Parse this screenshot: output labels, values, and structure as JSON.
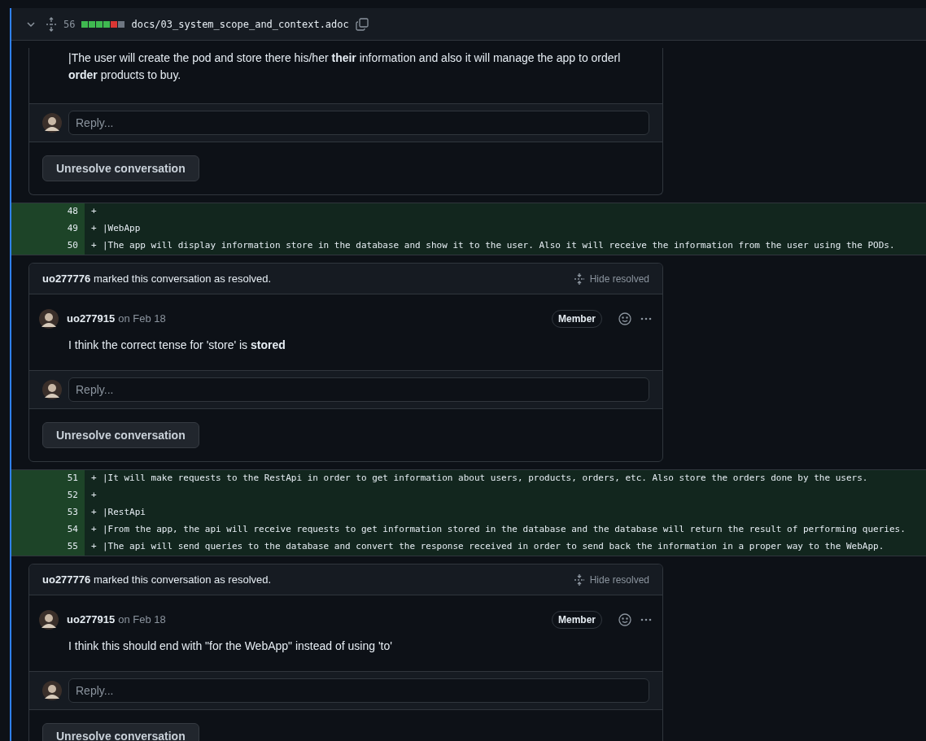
{
  "file_header": {
    "expanded": true,
    "changes": "56",
    "diffstat": [
      {
        "color": "#3fb950"
      },
      {
        "color": "#3fb950"
      },
      {
        "color": "#3fb950"
      },
      {
        "color": "#3fb950"
      },
      {
        "color": "#da3633"
      },
      {
        "color": "#6e7681"
      }
    ],
    "path": "docs/03_system_scope_and_context.adoc"
  },
  "items": [
    {
      "kind": "thread",
      "comments": [
        {
          "body": "|The user will create the pod and store there his/her **their** information and also it will manage the app to orderl **order** products to buy."
        }
      ],
      "reply_placeholder": "Reply...",
      "button": "Unresolve conversation"
    },
    {
      "kind": "diff",
      "lines": [
        {
          "number": "48",
          "sign": "+"
        },
        {
          "number": "49",
          "sign": "+",
          "code": "|WebApp"
        },
        {
          "number": "50",
          "sign": "+",
          "code": "|The app will display information store in the database and show it to the user. Also it will receive the information from the user using the PODs."
        }
      ]
    },
    {
      "kind": "thread",
      "resolved_by": "uo277776",
      "resolved_text": "marked this conversation as resolved.",
      "hide_label": "Hide resolved",
      "comments": [
        {
          "author": "uo277915",
          "date": "on Feb 18",
          "badge": "Member",
          "body": "I think the correct tense for 'store' is **stored**"
        }
      ],
      "reply_placeholder": "Reply...",
      "button": "Unresolve conversation"
    },
    {
      "kind": "diff",
      "lines": [
        {
          "number": "51",
          "sign": "+",
          "code": "|It will make requests to the RestApi in order to get information about users, products, orders, etc. Also store the orders done by the users."
        },
        {
          "number": "52",
          "sign": "+"
        },
        {
          "number": "53",
          "sign": "+",
          "code": "|RestApi"
        },
        {
          "number": "54",
          "sign": "+",
          "code": "|From the app, the api will receive requests to get information stored in the database and the database will return the result of performing queries."
        },
        {
          "number": "55",
          "sign": "+",
          "code": "|The api will send queries to the database and convert the response received in order to send back the information in a proper way to the WebApp."
        }
      ]
    },
    {
      "kind": "thread",
      "resolved_by": "uo277776",
      "resolved_text": "marked this conversation as resolved.",
      "hide_label": "Hide resolved",
      "comments": [
        {
          "author": "uo277915",
          "date": "on Feb 18",
          "badge": "Member",
          "body": "I think this should end with \"for the WebApp\" instead of using 'to'"
        }
      ],
      "reply_placeholder": "Reply...",
      "button": "Unresolve conversation"
    }
  ]
}
